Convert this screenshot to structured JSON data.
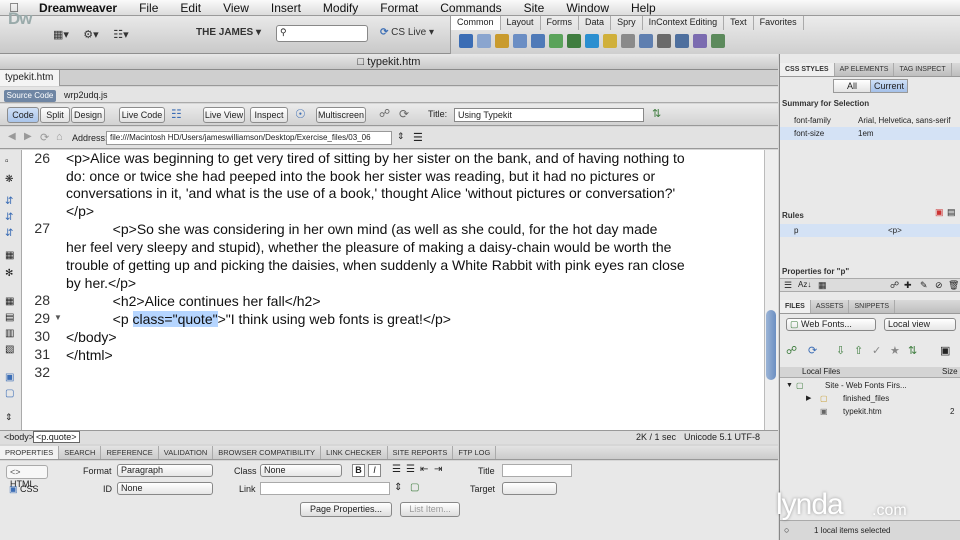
{
  "menubar": {
    "app": "Dreamweaver",
    "items": [
      "File",
      "Edit",
      "View",
      "Insert",
      "Modify",
      "Format",
      "Commands",
      "Site",
      "Window",
      "Help"
    ]
  },
  "toolbar": {
    "logo": "Dw",
    "site": "THE JAMES",
    "cs_live": "CS Live"
  },
  "insert_panel": {
    "tabs": [
      "Common",
      "Layout",
      "Forms",
      "Data",
      "Spry",
      "InContext Editing",
      "Text",
      "Favorites"
    ],
    "active_tab": "Common"
  },
  "document": {
    "window_title": "typekit.htm",
    "tab_label": "typekit.htm",
    "related_files": {
      "source_code": "Source Code",
      "file": "wrp2udq.js"
    },
    "view_buttons": {
      "code": "Code",
      "split": "Split",
      "design": "Design",
      "live_code": "Live Code",
      "live_view": "Live View",
      "inspect": "Inspect",
      "multiscreen": "Multiscreen"
    },
    "title_label": "Title:",
    "title_value": "Using Typekit",
    "address_label": "Address:",
    "address_value": "file:///Macintosh HD/Users/jameswilliamson/Desktop/Exercise_files/03_06"
  },
  "code": {
    "line_numbers": [
      "26",
      "",
      "",
      "",
      "27",
      "",
      "",
      "",
      "28",
      "29",
      "30",
      "31",
      "32"
    ],
    "lines": {
      "l26a": "<p>Alice was beginning to get very tired of sitting by her sister on the bank, and of having nothing to",
      "l26b": "do: once or twice she had peeped into the book her sister was reading, but it had no pictures or",
      "l26c": "conversations in it, 'and what is the use of a book,' thought Alice 'without pictures or conversation?'",
      "l26d": "</p>",
      "l27a": "            <p>So she was considering in her own mind (as well as she could, for the hot day made",
      "l27b": "her feel very sleepy and stupid), whether the pleasure of making a daisy-chain would be worth the",
      "l27c": "trouble of getting up and picking the daisies, when suddenly a White Rabbit with pink eyes ran close",
      "l27d": "by her.</p>",
      "l28": "            <h2>Alice continues her fall</h2>",
      "l29_pre": "            <p ",
      "l29_sel": "class=\"quote\"",
      "l29_post": ">\"I think using web fonts is great!</p>",
      "l30": "</body>",
      "l31": "</html>"
    }
  },
  "status": {
    "tags": [
      "<body>",
      "<p.quote>"
    ],
    "size": "2K / 1 sec",
    "encoding": "Unicode 5.1 UTF-8"
  },
  "properties": {
    "tabs": [
      "PROPERTIES",
      "SEARCH",
      "REFERENCE",
      "VALIDATION",
      "BROWSER COMPATIBILITY",
      "LINK CHECKER",
      "SITE REPORTS",
      "FTP LOG"
    ],
    "html_label": "HTML",
    "css_label": "CSS",
    "format_label": "Format",
    "format_value": "Paragraph",
    "class_label": "Class",
    "class_value": "None",
    "id_label": "ID",
    "id_value": "None",
    "link_label": "Link",
    "title_label": "Title",
    "target_label": "Target",
    "page_properties": "Page Properties...",
    "list_item": "List Item..."
  },
  "css_panel": {
    "tabs": [
      "CSS STYLES",
      "AP ELEMENTS",
      "TAG INSPECT"
    ],
    "all": "All",
    "current": "Current",
    "summary_heading": "Summary for Selection",
    "summary": [
      {
        "prop": "font-family",
        "value": "Arial, Helvetica, sans-serif"
      },
      {
        "prop": "font-size",
        "value": "1em"
      }
    ],
    "rules_heading": "Rules",
    "rule_selector": "p",
    "rule_tag": "<p>",
    "properties_heading": "Properties for \"p\""
  },
  "files_panel": {
    "tabs": [
      "FILES",
      "ASSETS",
      "SNIPPETS"
    ],
    "site_select": "Web Fonts...",
    "view_select": "Local view",
    "col_local": "Local Files",
    "col_size": "Size",
    "items": [
      {
        "name": "Site - Web Fonts Firs...",
        "size": ""
      },
      {
        "name": "finished_files",
        "size": ""
      },
      {
        "name": "typekit.htm",
        "size": "2"
      }
    ],
    "status": "1 local items selected"
  },
  "watermark": {
    "brand": "lynda",
    "suffix": ".com"
  }
}
